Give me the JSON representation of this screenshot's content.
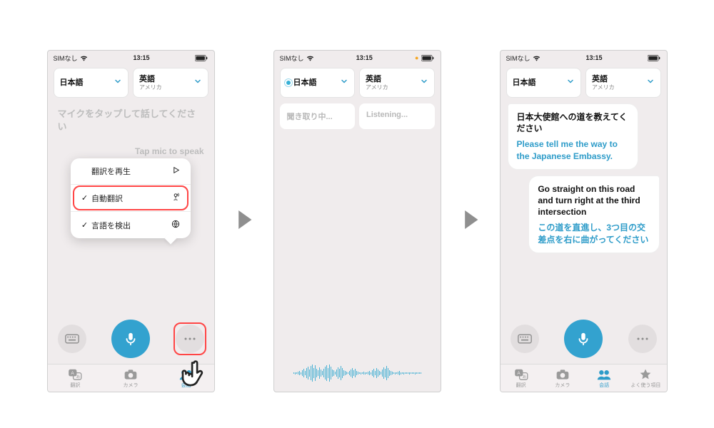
{
  "status": {
    "sim": "SIMなし",
    "time": "13:15"
  },
  "lang": {
    "left_main": "日本語",
    "left_sub": "",
    "right_main": "英語",
    "right_sub": "アメリカ"
  },
  "screen1": {
    "prompt_jp": "マイクをタップして話してください",
    "prompt_en": "Tap mic to speak",
    "menu": {
      "play": "翻訳を再生",
      "auto": "自動翻訳",
      "detect": "言語を検出"
    }
  },
  "screen2": {
    "listening_jp": "聞き取り中...",
    "listening_en": "Listening..."
  },
  "screen3": {
    "bubble1_src": "日本大使館への道を教えてください",
    "bubble1_tr": "Please tell me the way to the Japanese Embassy.",
    "bubble2_src": "Go straight on this road and turn right at the third intersection",
    "bubble2_tr": "この道を直進し、3つ目の交差点を右に曲がってください"
  },
  "tabs": {
    "translate": "翻訳",
    "camera": "カメラ",
    "conversation": "会話",
    "favorites": "よく使う項目"
  },
  "colors": {
    "accent": "#2e9cc9",
    "highlight": "#ff4545"
  }
}
